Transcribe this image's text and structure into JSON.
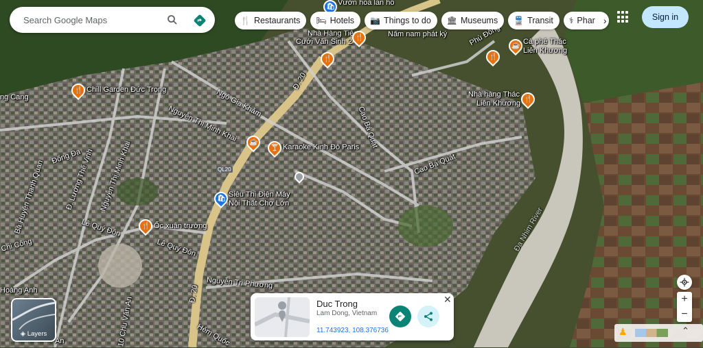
{
  "search": {
    "placeholder": "Search Google Maps"
  },
  "chips": [
    {
      "icon": "fork-knife-icon",
      "glyph": "🍴",
      "label": "Restaurants"
    },
    {
      "icon": "bed-icon",
      "glyph": "🛏",
      "label": "Hotels"
    },
    {
      "icon": "camera-icon",
      "glyph": "📷",
      "label": "Things to do"
    },
    {
      "icon": "museum-icon",
      "glyph": "🏛",
      "label": "Museums"
    },
    {
      "icon": "train-icon",
      "glyph": "🚆",
      "label": "Transit"
    },
    {
      "icon": "pharmacy-icon",
      "glyph": "⚕",
      "label": "Phar"
    }
  ],
  "header": {
    "signin_label": "Sign in"
  },
  "layers": {
    "label": "Layers"
  },
  "place_card": {
    "title": "Duc Trong",
    "subtitle": "Lam Dong, Vietnam",
    "coords": "11.743923, 108.376736"
  },
  "map_labels": {
    "vuon_hoa": "Vườn hoa lan hồ",
    "nha_hang_tiec": "Nhà Hàng Tiệc",
    "cuoi_van_sinh": "Cưới Văn Sinh 2",
    "nam_nam": "Nấm nam phát ký",
    "phu_dong": "Phù Đổng",
    "ca_phe_thac": "Cà phê Thác",
    "lien_khuong": "Liên Khương",
    "nha_hang_thac": "Nhà hàng Thác",
    "lien_khuong2": "Liên Khương",
    "chill_garden": "Chill Garden Đức Trọng",
    "ng_cang": "ng Cang",
    "ngo_gia_kham": "Ngô Gia Khảm",
    "d20_top": "Đ. 20",
    "cao_ba_quat": "Cao Bá Quát",
    "cao_ba_quat2": "Cao Bá Quát",
    "nguyen_thi_minh_khai": "Nguyễn Thị Minh Khai",
    "karaoke": "Karaoke Kinh Đô Paris",
    "ql20": "QL20",
    "sieu_thi1": "Siêu Thị Điện Máy",
    "sieu_thi2": "Nội Thất Chợ Lớn",
    "dong_da": "Đống Đa",
    "luong_the_vinh": "Đ. Lương Thế Vinh",
    "nguyen_thi_minh_khai2": "Nguyễn Thị Minh Khai",
    "ba_huyen": "Bà Huyện Thanh Quan",
    "le_quy_don": "Lê Quý Đôn",
    "le_quy_don2": "Lê Quý Đôn",
    "oc_xuan_truong": "Ốc xuân trường",
    "chi_cong": "Chi Công",
    "d20_bottom": "Đ. 20",
    "nguyen_tri_phuong": "Nguyễn Tri Phương",
    "hoang_anh": "Hoàng Anh",
    "chu_van_an": "10 Chu Văn An",
    "an": "An",
    "hem_quoc": "Hẻm Quốc",
    "da_nhim": "Đa Nhim River"
  },
  "colors": {
    "accent": "#1a73e8",
    "teal": "#0b8375",
    "signin_bg": "#c2e7ff"
  }
}
